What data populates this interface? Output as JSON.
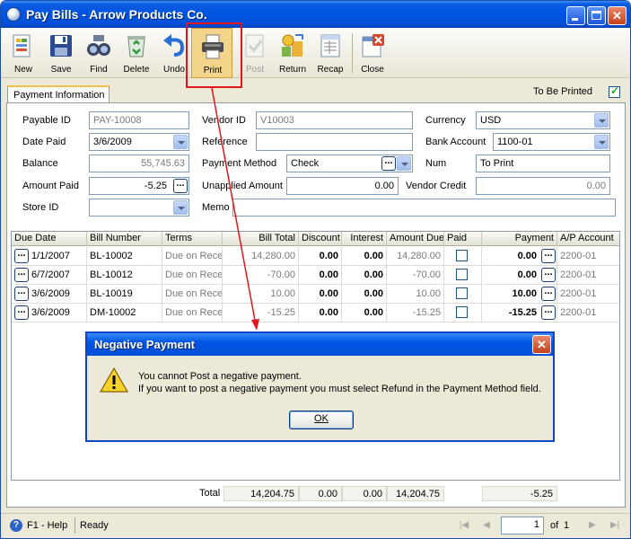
{
  "window": {
    "title": "Pay Bills - Arrow Products Co.",
    "controls": {
      "minimize": "_",
      "maximize": "□",
      "close": "✕"
    }
  },
  "toolbar": {
    "new": "New",
    "save": "Save",
    "find": "Find",
    "delete": "Delete",
    "undo": "Undo",
    "print": "Print",
    "post": "Post",
    "return": "Return",
    "recap": "Recap",
    "close": "Close"
  },
  "tab": {
    "label": "Payment Information"
  },
  "to_be_printed": {
    "label": "To Be Printed",
    "checked": true
  },
  "form": {
    "payable_id": {
      "label": "Payable ID",
      "value": "PAY-10008"
    },
    "date_paid": {
      "label": "Date Paid",
      "value": "3/6/2009"
    },
    "balance": {
      "label": "Balance",
      "value": "55,745.63"
    },
    "amount_paid": {
      "label": "Amount Paid",
      "value": "-5.25"
    },
    "store_id": {
      "label": "Store ID",
      "value": ""
    },
    "vendor_id": {
      "label": "Vendor ID",
      "value": "V10003"
    },
    "reference": {
      "label": "Reference",
      "value": ""
    },
    "payment_method": {
      "label": "Payment Method",
      "value": "Check"
    },
    "unapplied_amount": {
      "label": "Unapplied Amount",
      "value": "0.00"
    },
    "memo": {
      "label": "Memo",
      "value": ""
    },
    "currency": {
      "label": "Currency",
      "value": "USD"
    },
    "bank_account": {
      "label": "Bank Account",
      "value": "1100-01"
    },
    "num": {
      "label": "Num",
      "value": "To Print"
    },
    "vendor_credit": {
      "label": "Vendor Credit",
      "value": "0.00"
    }
  },
  "grid": {
    "columns": [
      "Due Date",
      "Bill Number",
      "Terms",
      "Bill Total",
      "Discount",
      "Interest",
      "Amount Due",
      "Paid",
      "Payment",
      "A/P Account"
    ],
    "rows": [
      {
        "due_date": "1/1/2007",
        "bill_number": "BL-10002",
        "terms": "Due on Rece",
        "bill_total": "14,280.00",
        "discount": "0.00",
        "interest": "0.00",
        "amount_due": "14,280.00",
        "paid": false,
        "payment": "0.00",
        "ap_account": "2200-01"
      },
      {
        "due_date": "6/7/2007",
        "bill_number": "BL-10012",
        "terms": "Due on Rece",
        "bill_total": "-70.00",
        "discount": "0.00",
        "interest": "0.00",
        "amount_due": "-70.00",
        "paid": false,
        "payment": "0.00",
        "ap_account": "2200-01"
      },
      {
        "due_date": "3/6/2009",
        "bill_number": "BL-10019",
        "terms": "Due on Rece",
        "bill_total": "10.00",
        "discount": "0.00",
        "interest": "0.00",
        "amount_due": "10.00",
        "paid": false,
        "payment": "10.00",
        "ap_account": "2200-01"
      },
      {
        "due_date": "3/6/2009",
        "bill_number": "DM-10002",
        "terms": "Due on Rece",
        "bill_total": "-15.25",
        "discount": "0.00",
        "interest": "0.00",
        "amount_due": "-15.25",
        "paid": false,
        "payment": "-15.25",
        "ap_account": "2200-01"
      }
    ]
  },
  "totals": {
    "label": "Total",
    "bill_total": "14,204.75",
    "discount": "0.00",
    "interest": "0.00",
    "amount_due": "14,204.75",
    "payment": "-5.25"
  },
  "status": {
    "help": "F1 - Help",
    "ready": "Ready",
    "page": "1",
    "of": "of",
    "total_pages": "1"
  },
  "dialog": {
    "title": "Negative Payment",
    "line1": "You cannot Post a negative payment.",
    "line2": "If you want to post a negative payment you must select Refund in the Payment Method field.",
    "ok": "OK"
  },
  "colors": {
    "titlebar": "#0054e3",
    "highlight": "#e0161c",
    "annotation_arrow": "#e0161c"
  }
}
